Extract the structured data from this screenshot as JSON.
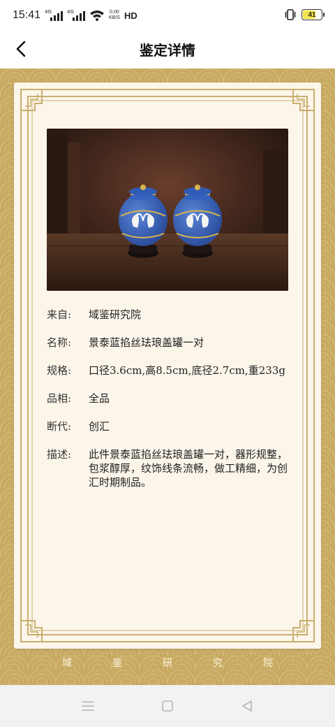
{
  "status_bar": {
    "time": "15:41",
    "signal1_tag": "4G",
    "signal2_tag": "4G",
    "net_speed_value": "0.00",
    "net_speed_unit": "KB/S",
    "hd_label": "HD",
    "battery_level": "41",
    "battery_color": "#f2e24b"
  },
  "nav": {
    "back_icon": "chevron-left-icon",
    "title": "鉴定详情"
  },
  "detail": {
    "photo_alt": "景泰蓝掐丝珐琅盖罐一对",
    "rows": [
      {
        "label": "来自:",
        "value": "域鉴研究院"
      },
      {
        "label": "名称:",
        "value": "景泰蓝掐丝珐琅盖罐一对"
      },
      {
        "label": "规格:",
        "value": "口径3.6cm,高8.5cm,底径2.7cm,重233g"
      },
      {
        "label": "品相:",
        "value": "全品"
      },
      {
        "label": "断代:",
        "value": "创汇"
      },
      {
        "label": "描述:",
        "value": "此件景泰蓝掐丝珐琅盖罐一对，器形规整，包浆醇厚，纹饰线条流畅，做工精细，为创汇时期制品。"
      }
    ]
  },
  "footer": {
    "chars": [
      "域",
      "鉴",
      "研",
      "究",
      "院"
    ]
  },
  "system_nav": {
    "menu_icon": "menu-icon",
    "home_icon": "home-square-icon",
    "back_icon": "back-triangle-icon"
  },
  "colors": {
    "gold": "#c8aa62",
    "paper": "#fcf5ea",
    "frame": "#c9ae6e"
  }
}
